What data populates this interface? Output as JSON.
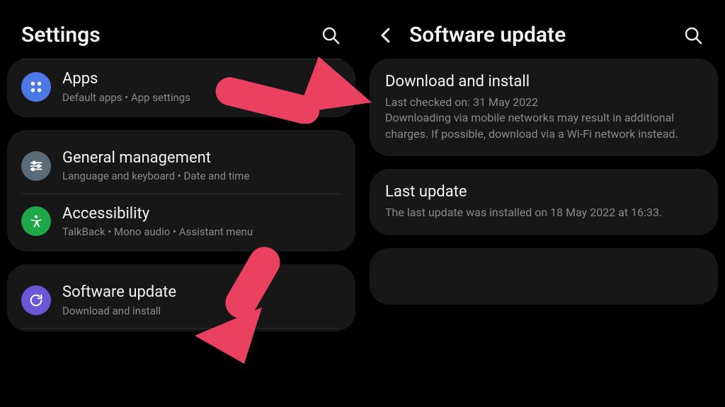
{
  "left": {
    "title": "Settings",
    "group1": {
      "apps": {
        "title": "Apps",
        "subtitle": "Default apps  •  App settings"
      }
    },
    "group2": {
      "general": {
        "title": "General management",
        "subtitle": "Language and keyboard  •  Date and time"
      },
      "accessibility": {
        "title": "Accessibility",
        "subtitle": "TalkBack  •  Mono audio  •  Assistant menu"
      }
    },
    "group3": {
      "software": {
        "title": "Software update",
        "subtitle": "Download and install"
      }
    }
  },
  "right": {
    "title": "Software update",
    "download": {
      "title": "Download and install",
      "line1": "Last checked on: 31 May 2022",
      "line2": "Downloading via mobile networks may result in additional charges. If possible, download via a Wi-Fi network instead."
    },
    "last": {
      "title": "Last update",
      "line": "The last update was installed on 18 May 2022 at 16:33."
    }
  }
}
